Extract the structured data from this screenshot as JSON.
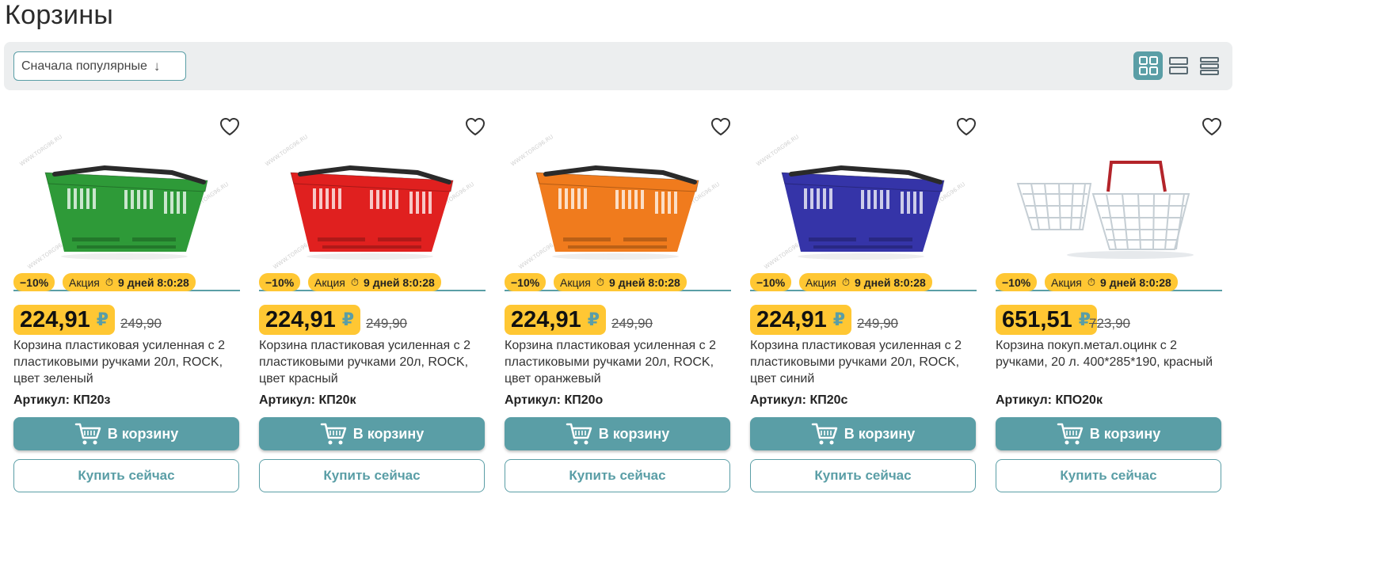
{
  "page": {
    "title": "Корзины"
  },
  "toolbar": {
    "sort_label": "Сначала популярные",
    "sort_arrow": "↓",
    "view_buttons": [
      "grid-view-icon",
      "rows-view-icon",
      "list-view-icon"
    ],
    "active_view": "grid"
  },
  "colors": {
    "accent": "#5a9ea6",
    "badge": "#ffc733"
  },
  "products": [
    {
      "discount": "−10%",
      "promo_label": "Акция",
      "promo_timer": "9 дней 8:0:28",
      "price": "224,91",
      "currency": "₽",
      "old_price": "249,90",
      "name": "Корзина пластиковая усиленная с 2 пластиковыми ручками 20л, ROCK, цвет зеленый",
      "sku_label": "Артикул:",
      "sku": "КП20з",
      "cart_label": "В корзину",
      "buy_label": "Купить сейчас",
      "image_color": "#2e9a38",
      "image_type": "plastic"
    },
    {
      "discount": "−10%",
      "promo_label": "Акция",
      "promo_timer": "9 дней 8:0:28",
      "price": "224,91",
      "currency": "₽",
      "old_price": "249,90",
      "name": "Корзина пластиковая усиленная с 2 пластиковыми ручками 20л, ROCK, цвет красный",
      "sku_label": "Артикул:",
      "sku": "КП20к",
      "cart_label": "В корзину",
      "buy_label": "Купить сейчас",
      "image_color": "#e0201f",
      "image_type": "plastic"
    },
    {
      "discount": "−10%",
      "promo_label": "Акция",
      "promo_timer": "9 дней 8:0:28",
      "price": "224,91",
      "currency": "₽",
      "old_price": "249,90",
      "name": "Корзина пластиковая усиленная с 2 пластиковыми ручками 20л, ROCK, цвет оранжевый",
      "sku_label": "Артикул:",
      "sku": "КП20о",
      "cart_label": "В корзину",
      "buy_label": "Купить сейчас",
      "image_color": "#f07b1d",
      "image_type": "plastic"
    },
    {
      "discount": "−10%",
      "promo_label": "Акция",
      "promo_timer": "9 дней 8:0:28",
      "price": "224,91",
      "currency": "₽",
      "old_price": "249,90",
      "name": "Корзина пластиковая усиленная с 2 пластиковыми ручками 20л, ROCK, цвет синий",
      "sku_label": "Артикул:",
      "sku": "КП20с",
      "cart_label": "В корзину",
      "buy_label": "Купить сейчас",
      "image_color": "#3534a8",
      "image_type": "plastic"
    },
    {
      "discount": "−10%",
      "promo_label": "Акция",
      "promo_timer": "9 дней 8:0:28",
      "price": "651,51",
      "currency": "₽",
      "old_price": "723,90",
      "name": "Корзина покуп.метал.оцинк с 2 ручками, 20 л. 400*285*190, красный",
      "sku_label": "Артикул:",
      "sku": "КПО20к",
      "cart_label": "В корзину",
      "buy_label": "Купить сейчас",
      "image_color": "#b8c4cc",
      "image_type": "metal"
    }
  ]
}
